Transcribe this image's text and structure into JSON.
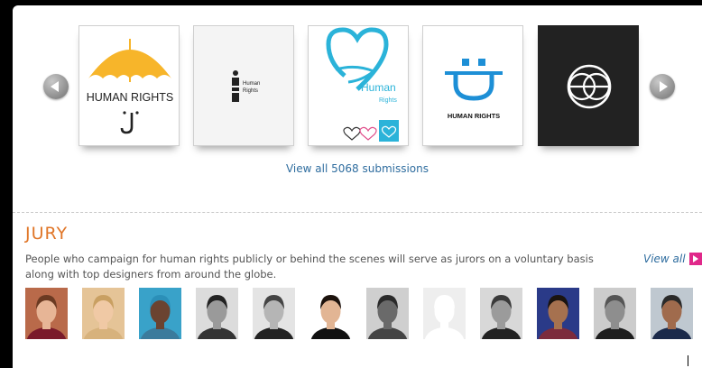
{
  "carousel": {
    "prev_icon": "chevron-left-icon",
    "next_icon": "chevron-right-icon",
    "submissions": [
      {
        "name": "umbrella-logo",
        "text": "HUMAN RIGHTS",
        "accent": "#f7b52a"
      },
      {
        "name": "figure-logo",
        "text_line1": "Human",
        "text_line2": "Rights",
        "accent": "#222222"
      },
      {
        "name": "heart-logo",
        "text_line1": "Human",
        "text_line2": "Rights",
        "accent": "#2bb3d9"
      },
      {
        "name": "smile-logo",
        "text": "HUMAN RIGHTS",
        "accent": "#1d8fd6"
      },
      {
        "name": "globe-logo",
        "accent": "#222222"
      }
    ],
    "view_all_label": "View all 5068 submissions"
  },
  "jury": {
    "title": "JURY",
    "description": "People who campaign for human rights publicly or behind the scenes will serve as jurors on a voluntary basis along with top designers from around the globe.",
    "view_all_label": "View all",
    "jurors": [
      {
        "bg": "#b96a4a",
        "skin": "#e7b596",
        "hair": "#6b3a22",
        "shirt": "#7a1a2a"
      },
      {
        "bg": "#e5c497",
        "skin": "#f0c9a5",
        "hair": "#c9a062",
        "shirt": "#d7b27c"
      },
      {
        "bg": "#39a2c9",
        "skin": "#6b4330",
        "hair": "#2b8fb8",
        "shirt": "#3b7b9c"
      },
      {
        "bg": "#dcdcdc",
        "skin": "#9a9a9a",
        "hair": "#222222",
        "shirt": "#333333"
      },
      {
        "bg": "#e4e4e4",
        "skin": "#b5b5b5",
        "hair": "#444444",
        "shirt": "#222222"
      },
      {
        "bg": "#ffffff",
        "skin": "#e2b594",
        "hair": "#1c120d",
        "shirt": "#111111"
      },
      {
        "bg": "#cfcfcf",
        "skin": "#6a6a6a",
        "hair": "#2a2a2a",
        "shirt": "#444444"
      },
      {
        "bg": "#eeeeee",
        "skin": "#ffffff",
        "hair": "#ffffff",
        "shirt": "#ffffff"
      },
      {
        "bg": "#d8d8d8",
        "skin": "#9b9b9b",
        "hair": "#3a3a3a",
        "shirt": "#222222"
      },
      {
        "bg": "#2a3a88",
        "skin": "#a6714f",
        "hair": "#1b1410",
        "shirt": "#7c2b3c"
      },
      {
        "bg": "#cccccc",
        "skin": "#8e8e8e",
        "hair": "#555555",
        "shirt": "#1e1e1e"
      },
      {
        "bg": "#bfc8d0",
        "skin": "#a06b4d",
        "hair": "#2a2a2a",
        "shirt": "#1b2a4a"
      }
    ]
  }
}
